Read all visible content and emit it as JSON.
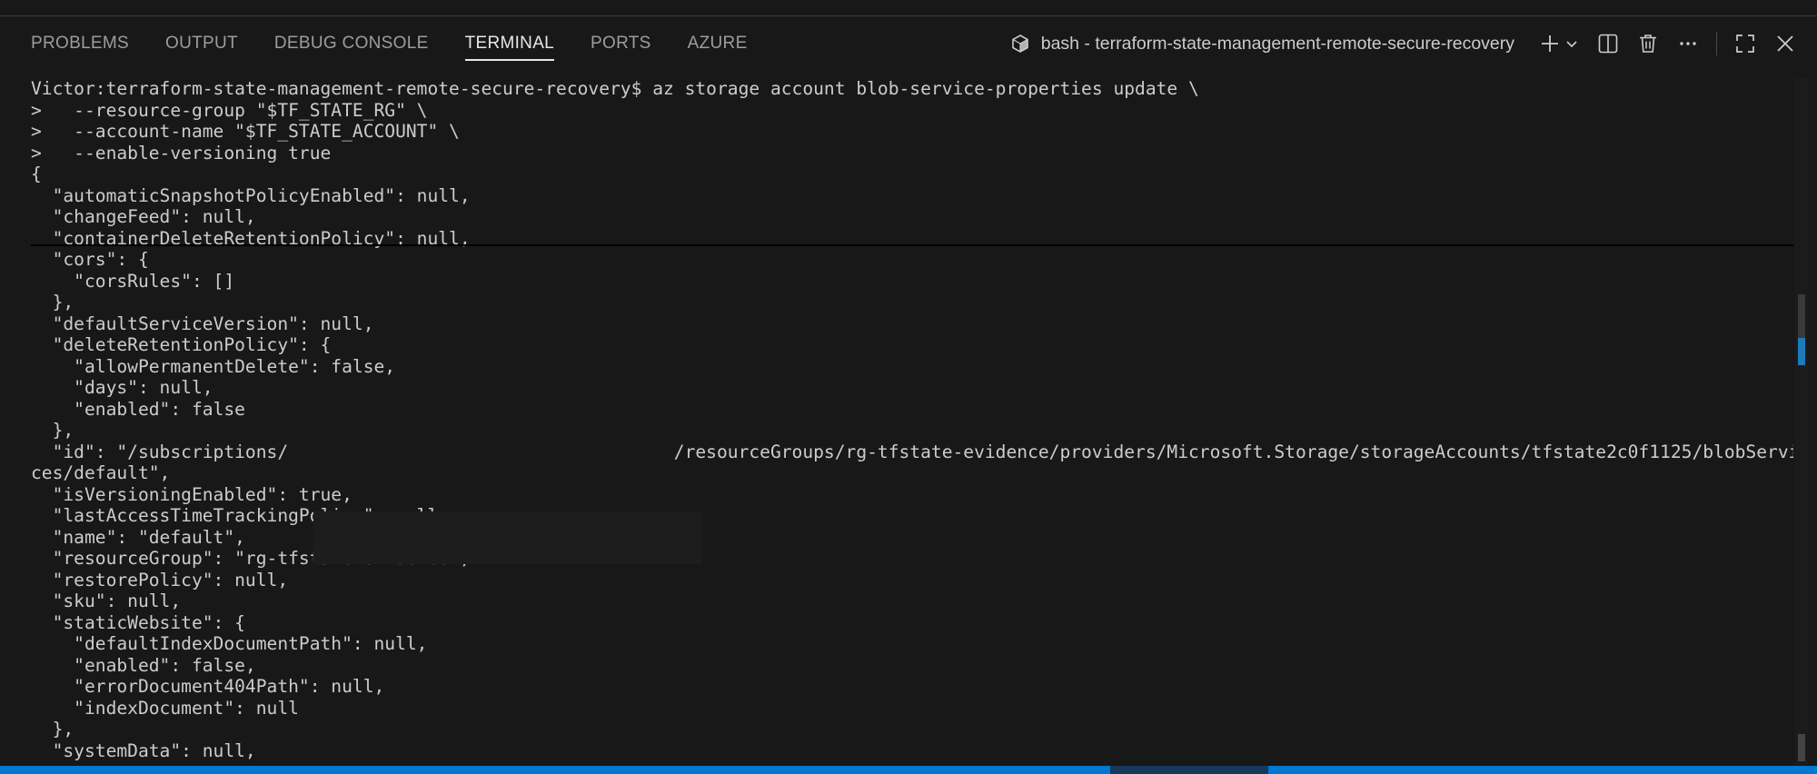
{
  "panel": {
    "tabs": [
      {
        "label": "PROBLEMS"
      },
      {
        "label": "OUTPUT"
      },
      {
        "label": "DEBUG CONSOLE"
      },
      {
        "label": "TERMINAL",
        "active": true
      },
      {
        "label": "PORTS"
      },
      {
        "label": "AZURE"
      }
    ],
    "terminal_title": "bash - terraform-state-management-remote-secure-recovery",
    "actions": [
      "plus-icon",
      "chevron-down-icon",
      "split-terminal-icon",
      "trash-icon",
      "more-icon",
      "maximize-icon",
      "close-icon"
    ]
  },
  "terminal": {
    "lines": [
      "Victor:terraform-state-management-remote-secure-recovery$ az storage account blob-service-properties update \\",
      ">   --resource-group \"$TF_STATE_RG\" \\",
      ">   --account-name \"$TF_STATE_ACCOUNT\" \\",
      ">   --enable-versioning true",
      "{",
      "  \"automaticSnapshotPolicyEnabled\": null,",
      "  \"changeFeed\": null,",
      "  \"containerDeleteRetentionPolicy\": null,",
      "  \"cors\": {",
      "    \"corsRules\": []",
      "  },",
      "  \"defaultServiceVersion\": null,",
      "  \"deleteRetentionPolicy\": {",
      "    \"allowPermanentDelete\": false,",
      "    \"days\": null,",
      "    \"enabled\": false",
      "  },",
      "  \"id\": \"/subscriptions/                                    /resourceGroups/rg-tfstate-evidence/providers/Microsoft.Storage/storageAccounts/tfstate2c0f1125/blobServi",
      "ces/default\",",
      "  \"isVersioningEnabled\": true,",
      "  \"lastAccessTimeTrackingPolicy\": null,",
      "  \"name\": \"default\",",
      "  \"resourceGroup\": \"rg-tfstate-evidence\",",
      "  \"restorePolicy\": null,",
      "  \"sku\": null,",
      "  \"staticWebsite\": {",
      "    \"defaultIndexDocumentPath\": null,",
      "    \"enabled\": false,",
      "    \"errorDocument404Path\": null,",
      "    \"indexDocument\": null",
      "  },",
      "  \"systemData\": null,"
    ]
  },
  "colors": {
    "background": "#181818",
    "text": "#cccccc",
    "statusbar": "#0078d4"
  }
}
